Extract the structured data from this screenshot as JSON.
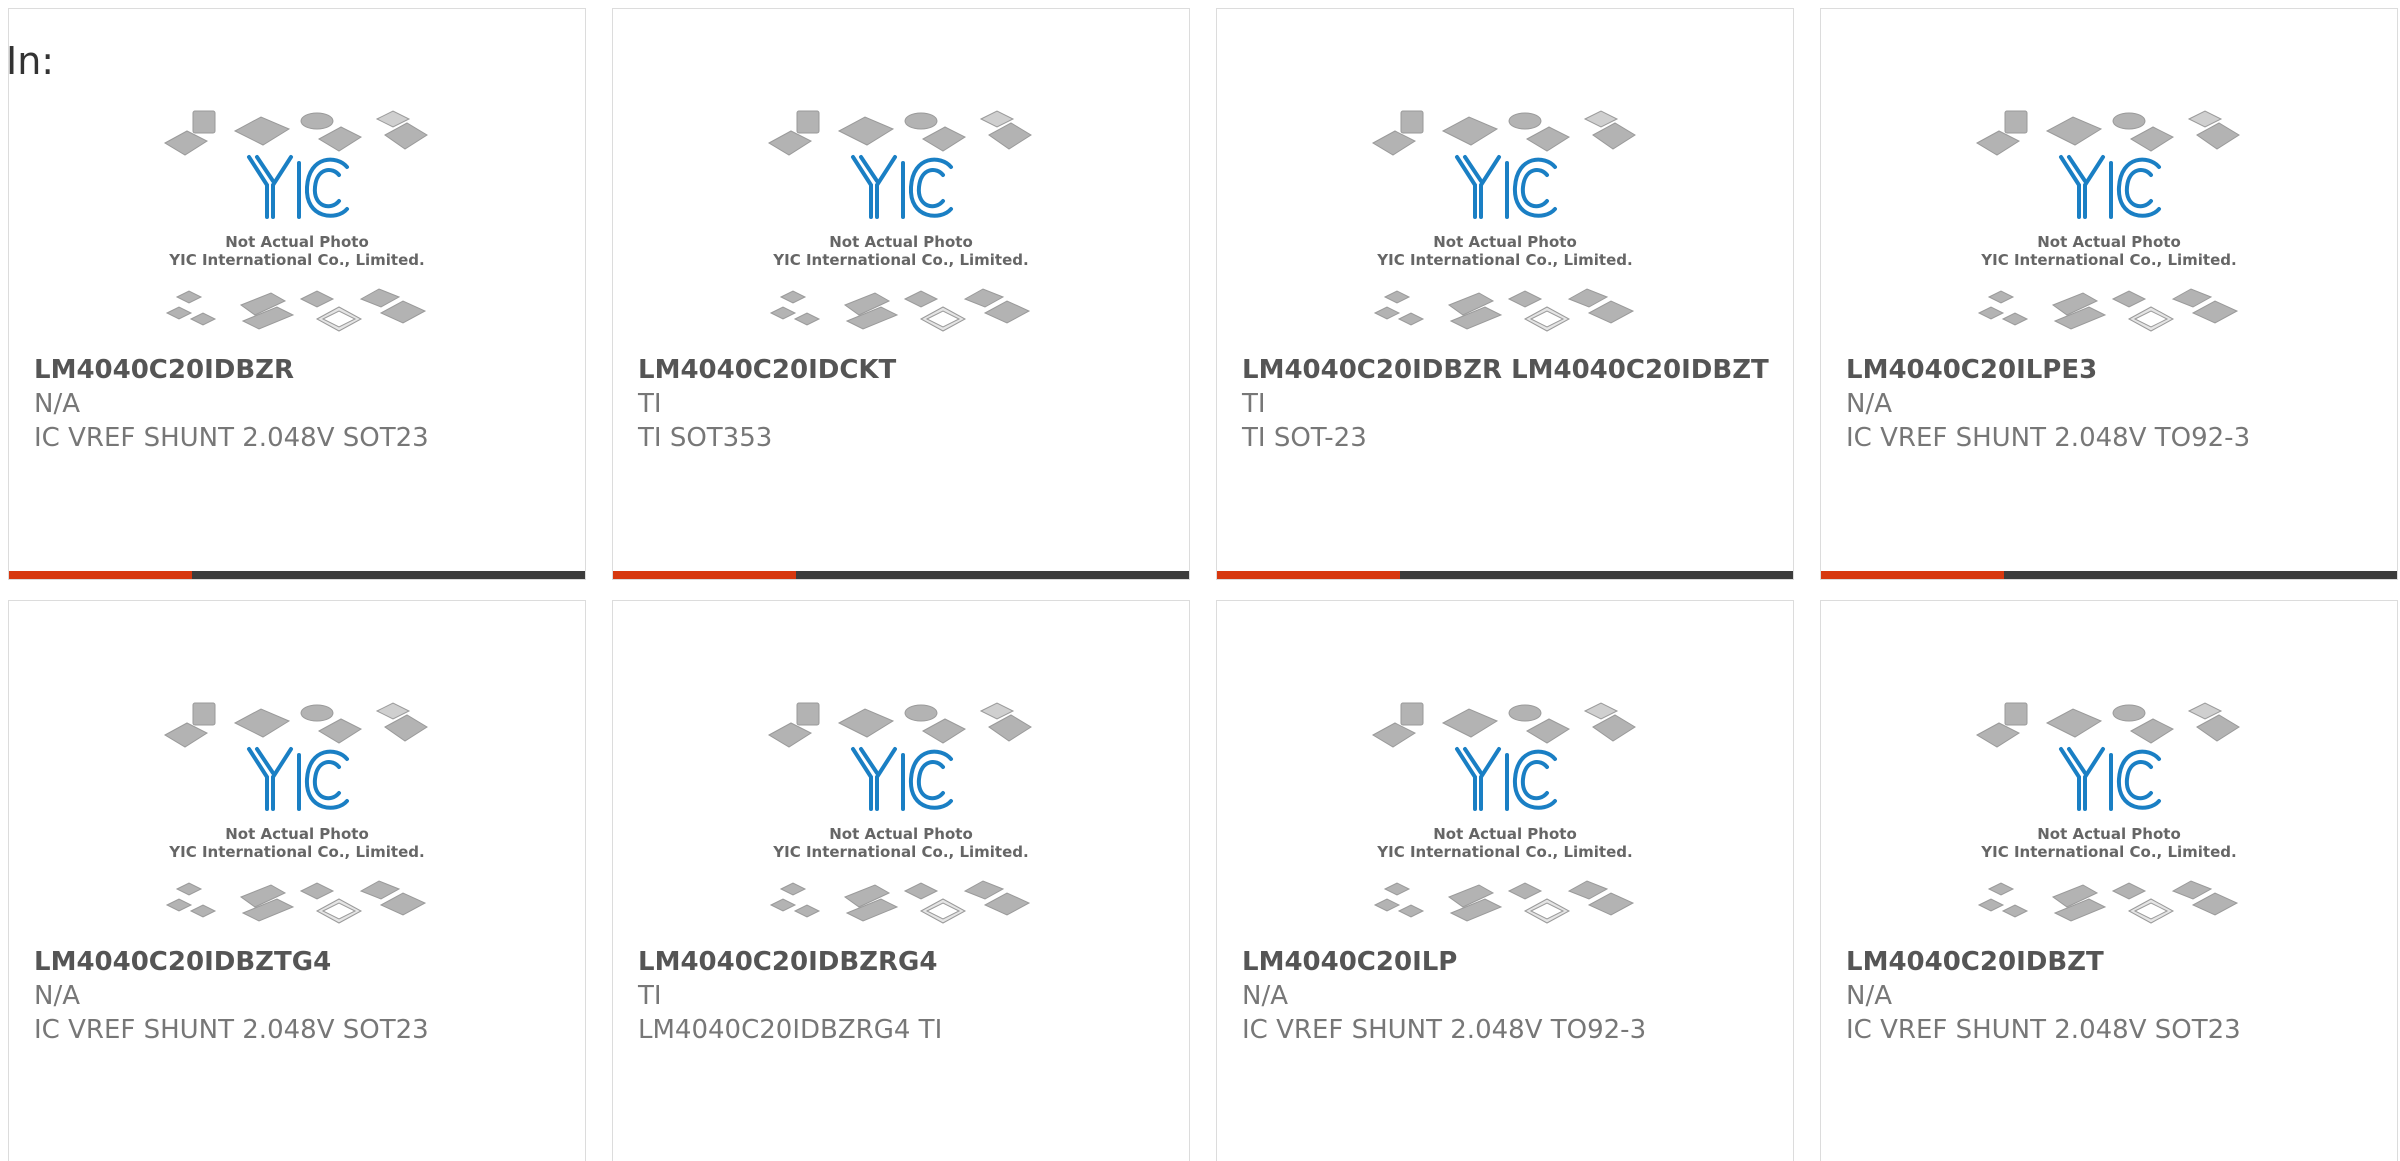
{
  "header": {
    "label": "In:"
  },
  "colors": {
    "accent": "#d7380f",
    "bar": "#3c3c3c",
    "logo": "#1a7fc4"
  },
  "placeholder": {
    "line1": "Not Actual Photo",
    "line2": "YIC International Co., Limited.",
    "logo_text": "YIC"
  },
  "products": [
    {
      "part": "LM4040C20IDBZR",
      "maker": "N/A",
      "desc": "IC VREF SHUNT 2.048V SOT23"
    },
    {
      "part": "LM4040C20IDCKT",
      "maker": "TI",
      "desc": "TI SOT353"
    },
    {
      "part": "LM4040C20IDBZR LM4040C20IDBZT",
      "maker": "TI",
      "desc": "TI SOT-23"
    },
    {
      "part": "LM4040C20ILPE3",
      "maker": "N/A",
      "desc": "IC VREF SHUNT 2.048V TO92-3"
    },
    {
      "part": "LM4040C20IDBZTG4",
      "maker": "N/A",
      "desc": "IC VREF SHUNT 2.048V SOT23"
    },
    {
      "part": "LM4040C20IDBZRG4",
      "maker": "TI",
      "desc": "LM4040C20IDBZRG4 TI"
    },
    {
      "part": "LM4040C20ILP",
      "maker": "N/A",
      "desc": "IC VREF SHUNT 2.048V TO92-3"
    },
    {
      "part": "LM4040C20IDBZT",
      "maker": "N/A",
      "desc": "IC VREF SHUNT 2.048V SOT23"
    }
  ]
}
